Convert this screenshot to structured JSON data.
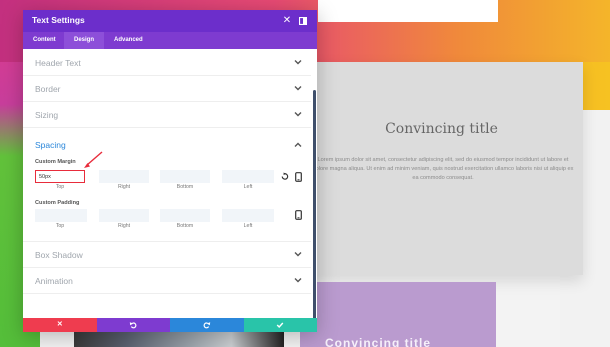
{
  "modal": {
    "title": "Text Settings",
    "tabs": [
      {
        "label": "Content"
      },
      {
        "label": "Design"
      },
      {
        "label": "Advanced"
      }
    ],
    "active_tab": "Design",
    "sections": {
      "header_text": "Header Text",
      "border": "Border",
      "sizing": "Sizing",
      "spacing": "Spacing",
      "box_shadow": "Box Shadow",
      "animation": "Animation"
    },
    "custom_margin": {
      "label": "Custom Margin",
      "top_value": "50px",
      "captions": [
        "Top",
        "Right",
        "Bottom",
        "Left"
      ]
    },
    "custom_padding": {
      "label": "Custom Padding",
      "captions": [
        "Top",
        "Right",
        "Bottom",
        "Left"
      ]
    },
    "footer_icons": [
      "close-icon",
      "undo-icon",
      "redo-icon",
      "check-icon"
    ]
  },
  "colors": {
    "header": "#6c2ecb",
    "tabs": "#7e3bd0",
    "accent_blue": "#2b87da",
    "cancel": "#ef3c4f",
    "undo": "#7e3bd0",
    "redo": "#2b87da",
    "save": "#29c4a9"
  },
  "preview": {
    "title": "Convincing title",
    "body": "Lorem ipsum dolor sit amet, consectetur adipiscing elit, sed do eiusmod tempor incididunt ut labore et dolore magna aliqua. Ut enim ad minim veniam, quis nostrud exercitation ullamco laboris nisi ut aliquip ex ea commodo consequat.",
    "lower_text": "Convincing title"
  }
}
